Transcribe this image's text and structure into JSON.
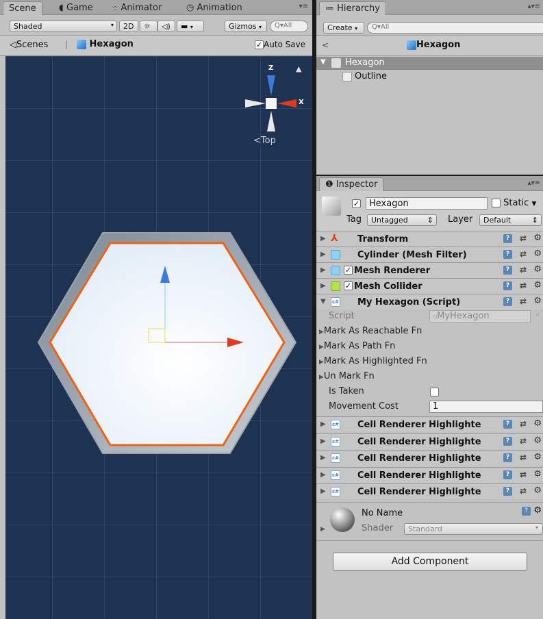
{
  "scene_tabs": [
    {
      "label": "Scene",
      "icon": "scene-icon"
    },
    {
      "label": "Game",
      "icon": "game-pacman-icon"
    },
    {
      "label": "Animator",
      "icon": "animator-icon"
    },
    {
      "label": "Animation",
      "icon": "clock-icon"
    }
  ],
  "scene_toolbar": {
    "shading": "Shaded",
    "mode2d": "2D",
    "gizmos": "Gizmos",
    "search": "Q▾All"
  },
  "prefab_bar": {
    "scenes": "Scenes",
    "separator": "|",
    "object": "Hexagon",
    "autosave": "Auto Save"
  },
  "gizmo": {
    "z": "Z",
    "x": "X",
    "view": "Top"
  },
  "hierarchy": {
    "tab": "Hierarchy",
    "create": "Create",
    "search": "Q▾All",
    "root": "Hexagon",
    "items": [
      {
        "label": "Hexagon",
        "selected": true
      },
      {
        "label": "Outline",
        "selected": false
      }
    ]
  },
  "inspector": {
    "tab": "Inspector",
    "name": "Hexagon",
    "static": "Static",
    "tag_label": "Tag",
    "tag": "Untagged",
    "layer_label": "Layer",
    "layer": "Default",
    "components": [
      {
        "label": "Transform",
        "check": false,
        "icon": "transform-icon"
      },
      {
        "label": "Cylinder (Mesh Filter)",
        "check": false,
        "icon": "mesh-filter-icon"
      },
      {
        "label": "Mesh Renderer",
        "check": true,
        "icon": "mesh-renderer-icon"
      },
      {
        "label": "Mesh Collider",
        "check": true,
        "icon": "mesh-collider-icon"
      },
      {
        "label": "My Hexagon (Script)",
        "check": false,
        "icon": "script-icon"
      }
    ],
    "script": {
      "label": "Script",
      "value": "MyHexagon",
      "events": [
        "Mark As Reachable Fn",
        "Mark As Path Fn",
        "Mark As Highlighted Fn",
        "Un Mark Fn"
      ],
      "is_taken_label": "Is Taken",
      "movement_cost_label": "Movement Cost",
      "movement_cost": "1"
    },
    "renderers": [
      "Cell Renderer Highlighte",
      "Cell Renderer Highlighte",
      "Cell Renderer Highlighte",
      "Cell Renderer Highlighte",
      "Cell Renderer Highlighte"
    ],
    "material": {
      "name": "No Name",
      "shader_label": "Shader",
      "shader": "Standard"
    },
    "add_component": "Add Component"
  },
  "colors": {
    "scene_bg": "#1e3352",
    "hex_border": "#ef6414",
    "axis_red": "#e03b1e",
    "axis_blue": "#3b7bdc"
  }
}
